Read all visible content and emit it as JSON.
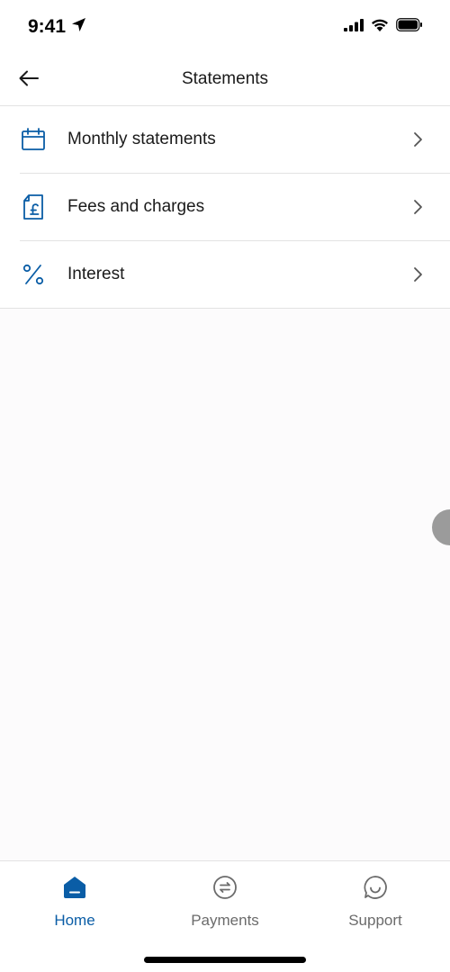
{
  "status_bar": {
    "time": "9:41",
    "location_icon": "location-arrow-icon",
    "signal_icon": "cellular-signal-icon",
    "wifi_icon": "wifi-icon",
    "battery_icon": "battery-icon"
  },
  "nav": {
    "back_icon": "arrow-left-icon",
    "title": "Statements"
  },
  "menu": {
    "items": [
      {
        "label": "Monthly statements",
        "icon": "calendar-icon"
      },
      {
        "label": "Fees and charges",
        "icon": "document-pound-icon"
      },
      {
        "label": "Interest",
        "icon": "percent-icon"
      }
    ],
    "chevron_icon": "chevron-right-icon"
  },
  "tab_bar": {
    "tabs": [
      {
        "label": "Home",
        "icon": "home-icon",
        "active": true
      },
      {
        "label": "Payments",
        "icon": "transfer-arrows-icon",
        "active": false
      },
      {
        "label": "Support",
        "icon": "chat-smile-icon",
        "active": false
      }
    ]
  },
  "colors": {
    "accent": "#0a5da6",
    "text": "#1a1a1a",
    "muted": "#6b6b6b",
    "divider": "#e3e3e3",
    "background": "#fcfbfc"
  }
}
